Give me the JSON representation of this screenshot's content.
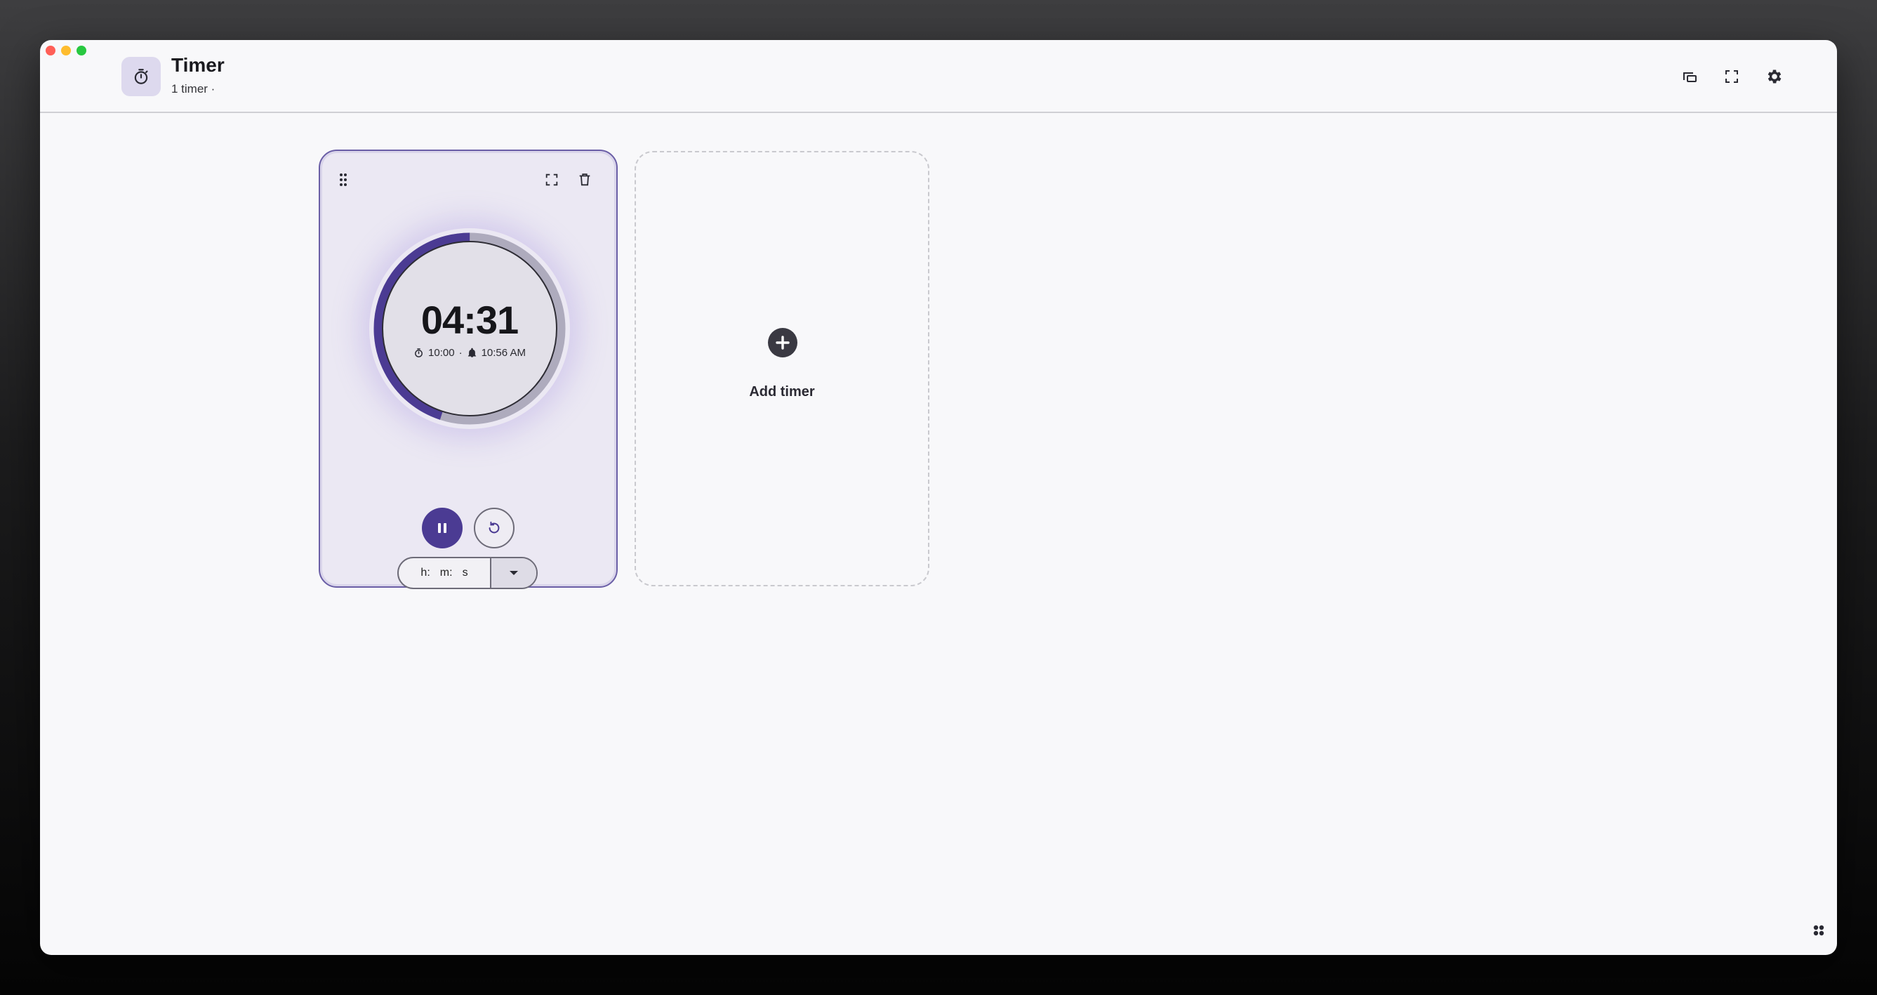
{
  "window": {
    "title": "Timer",
    "subtitle": "1 timer ·"
  },
  "header_icons": {
    "app": "stopwatch-icon",
    "pip": "picture-in-picture-icon",
    "fullscreen": "fullscreen-icon",
    "settings": "gear-icon"
  },
  "timer": {
    "remaining": "04:31",
    "duration": "10:00",
    "separator": "·",
    "alarm_time": "10:56 AM",
    "progress_remaining_fraction": 0.45,
    "state": "running",
    "input": {
      "hours_label": "h",
      "minutes_label": "m",
      "seconds_label": "s",
      "sep": ":"
    }
  },
  "add_card": {
    "label": "Add timer"
  },
  "colors": {
    "accent": "#4b3b93",
    "ring_track": "#aeabbd",
    "card_bg": "#ebe8f3"
  }
}
